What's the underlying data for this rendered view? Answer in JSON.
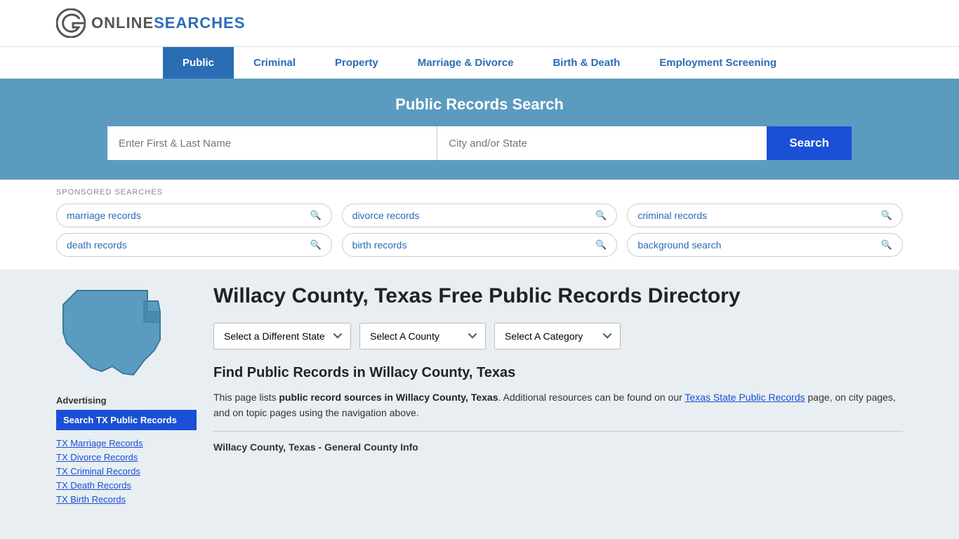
{
  "site": {
    "logo_text_online": "ONLINE",
    "logo_text_searches": "SEARCHES"
  },
  "nav": {
    "items": [
      {
        "label": "Public",
        "active": true
      },
      {
        "label": "Criminal",
        "active": false
      },
      {
        "label": "Property",
        "active": false
      },
      {
        "label": "Marriage & Divorce",
        "active": false
      },
      {
        "label": "Birth & Death",
        "active": false
      },
      {
        "label": "Employment Screening",
        "active": false
      }
    ]
  },
  "hero": {
    "title": "Public Records Search",
    "name_placeholder": "Enter First & Last Name",
    "location_placeholder": "City and/or State",
    "search_label": "Search"
  },
  "sponsored": {
    "label": "SPONSORED SEARCHES",
    "tags": [
      "marriage records",
      "divorce records",
      "criminal records",
      "death records",
      "birth records",
      "background search"
    ]
  },
  "sidebar": {
    "advertising_label": "Advertising",
    "ad_button_label": "Search TX Public Records",
    "links": [
      "TX Marriage Records",
      "TX Divorce Records",
      "TX Criminal Records",
      "TX Death Records",
      "TX Birth Records"
    ]
  },
  "content": {
    "page_title": "Willacy County, Texas Free Public Records Directory",
    "dropdowns": {
      "state_label": "Select a Different State",
      "county_label": "Select A County",
      "category_label": "Select A Category"
    },
    "find_title": "Find Public Records in Willacy County, Texas",
    "description_part1": "This page lists ",
    "description_bold": "public record sources in Willacy County, Texas",
    "description_part2": ". Additional resources can be found on our ",
    "description_link": "Texas State Public Records",
    "description_part3": " page, on city pages, and on topic pages using the navigation above.",
    "county_info_header": "Willacy County, Texas - General County Info"
  }
}
